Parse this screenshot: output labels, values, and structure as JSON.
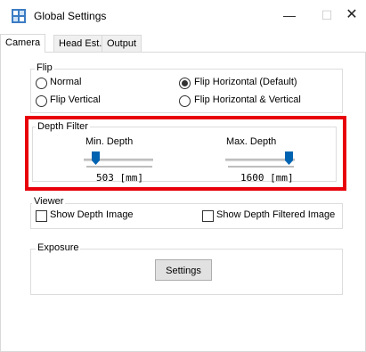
{
  "window": {
    "title": "Global Settings",
    "icon": "app-icon",
    "minimize": "—",
    "maximize": "☐",
    "close": "✕"
  },
  "tabs": [
    {
      "label": "Camera",
      "active": true
    },
    {
      "label": "Head Est.",
      "active": false
    },
    {
      "label": "Output",
      "active": false
    }
  ],
  "flip": {
    "title": "Flip",
    "options": [
      {
        "label": "Normal",
        "checked": false
      },
      {
        "label": "Flip Horizontal (Default)",
        "checked": true
      },
      {
        "label": "Flip Vertical",
        "checked": false
      },
      {
        "label": "Flip Horizontal & Vertical",
        "checked": false
      }
    ]
  },
  "depth_filter": {
    "title": "Depth Filter",
    "min": {
      "label": "Min. Depth",
      "value_text": "503 [mm]",
      "position": 0.17
    },
    "max": {
      "label": "Max. Depth",
      "value_text": "1600 [mm]",
      "position": 0.95
    }
  },
  "viewer": {
    "title": "Viewer",
    "options": [
      {
        "label": "Show Depth Image",
        "checked": false
      },
      {
        "label": "Show Depth Filtered Image",
        "checked": false
      }
    ]
  },
  "exposure": {
    "title": "Exposure",
    "button": "Settings"
  },
  "colors": {
    "highlight": "#e8000b",
    "slider_thumb": "#0063b1"
  }
}
